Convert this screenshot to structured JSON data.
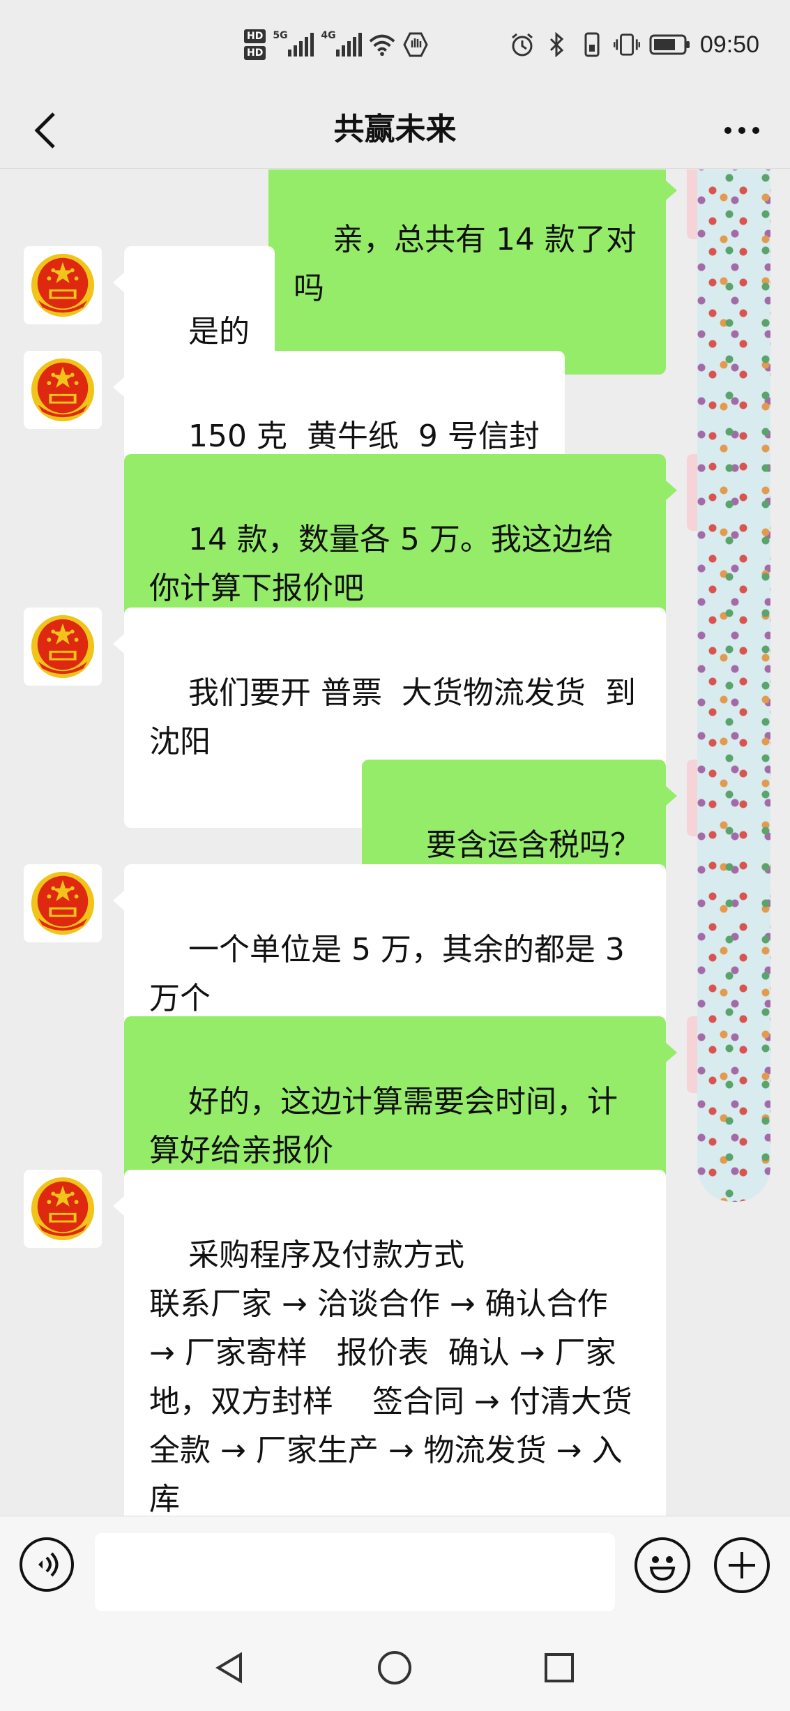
{
  "status_bar": {
    "hd1": "HD",
    "hd2": "HD",
    "net1": "5G",
    "net2": "4G",
    "time": "09:50"
  },
  "header": {
    "title": "共赢未来"
  },
  "messages": [
    {
      "side": "out",
      "text": "亲，总共有 14 款了对吗"
    },
    {
      "side": "in",
      "text": "是的"
    },
    {
      "side": "in",
      "text": "150 克  黄牛纸  9 号信封"
    },
    {
      "side": "out",
      "text": "14 款，数量各 5 万。我这边给你计算下报价吧"
    },
    {
      "side": "in",
      "text": "我们要开 普票  大货物流发货  到沈阳"
    },
    {
      "side": "out",
      "text": "要含运含税吗？"
    },
    {
      "side": "in",
      "text": "一个单位是 5 万，其余的都是 3 万个"
    },
    {
      "side": "out",
      "text": "好的，这边计算需要会时间，计算好给亲报价"
    },
    {
      "side": "in",
      "text": "采购程序及付款方式\n联系厂家 → 洽谈合作 → 确认合作 → 厂家寄样   报价表  确认 → 厂家地，双方封样    签合同 → 付清大货全款 → 厂家生产 → 物流发货 → 入库"
    }
  ],
  "input_bar": {
    "message_value": ""
  },
  "colors": {
    "background": "#ededed",
    "outgoing_bubble": "#95ec69",
    "incoming_bubble": "#ffffff"
  },
  "icons": {
    "back": "chevron-left-icon",
    "more": "more-dots-icon",
    "avatar": "national-emblem-avatar",
    "voice": "voice-icon",
    "emoji": "emoji-icon",
    "plus": "plus-icon",
    "nav_back": "triangle-back-icon",
    "nav_home": "circle-home-icon",
    "nav_recent": "square-recent-icon"
  }
}
